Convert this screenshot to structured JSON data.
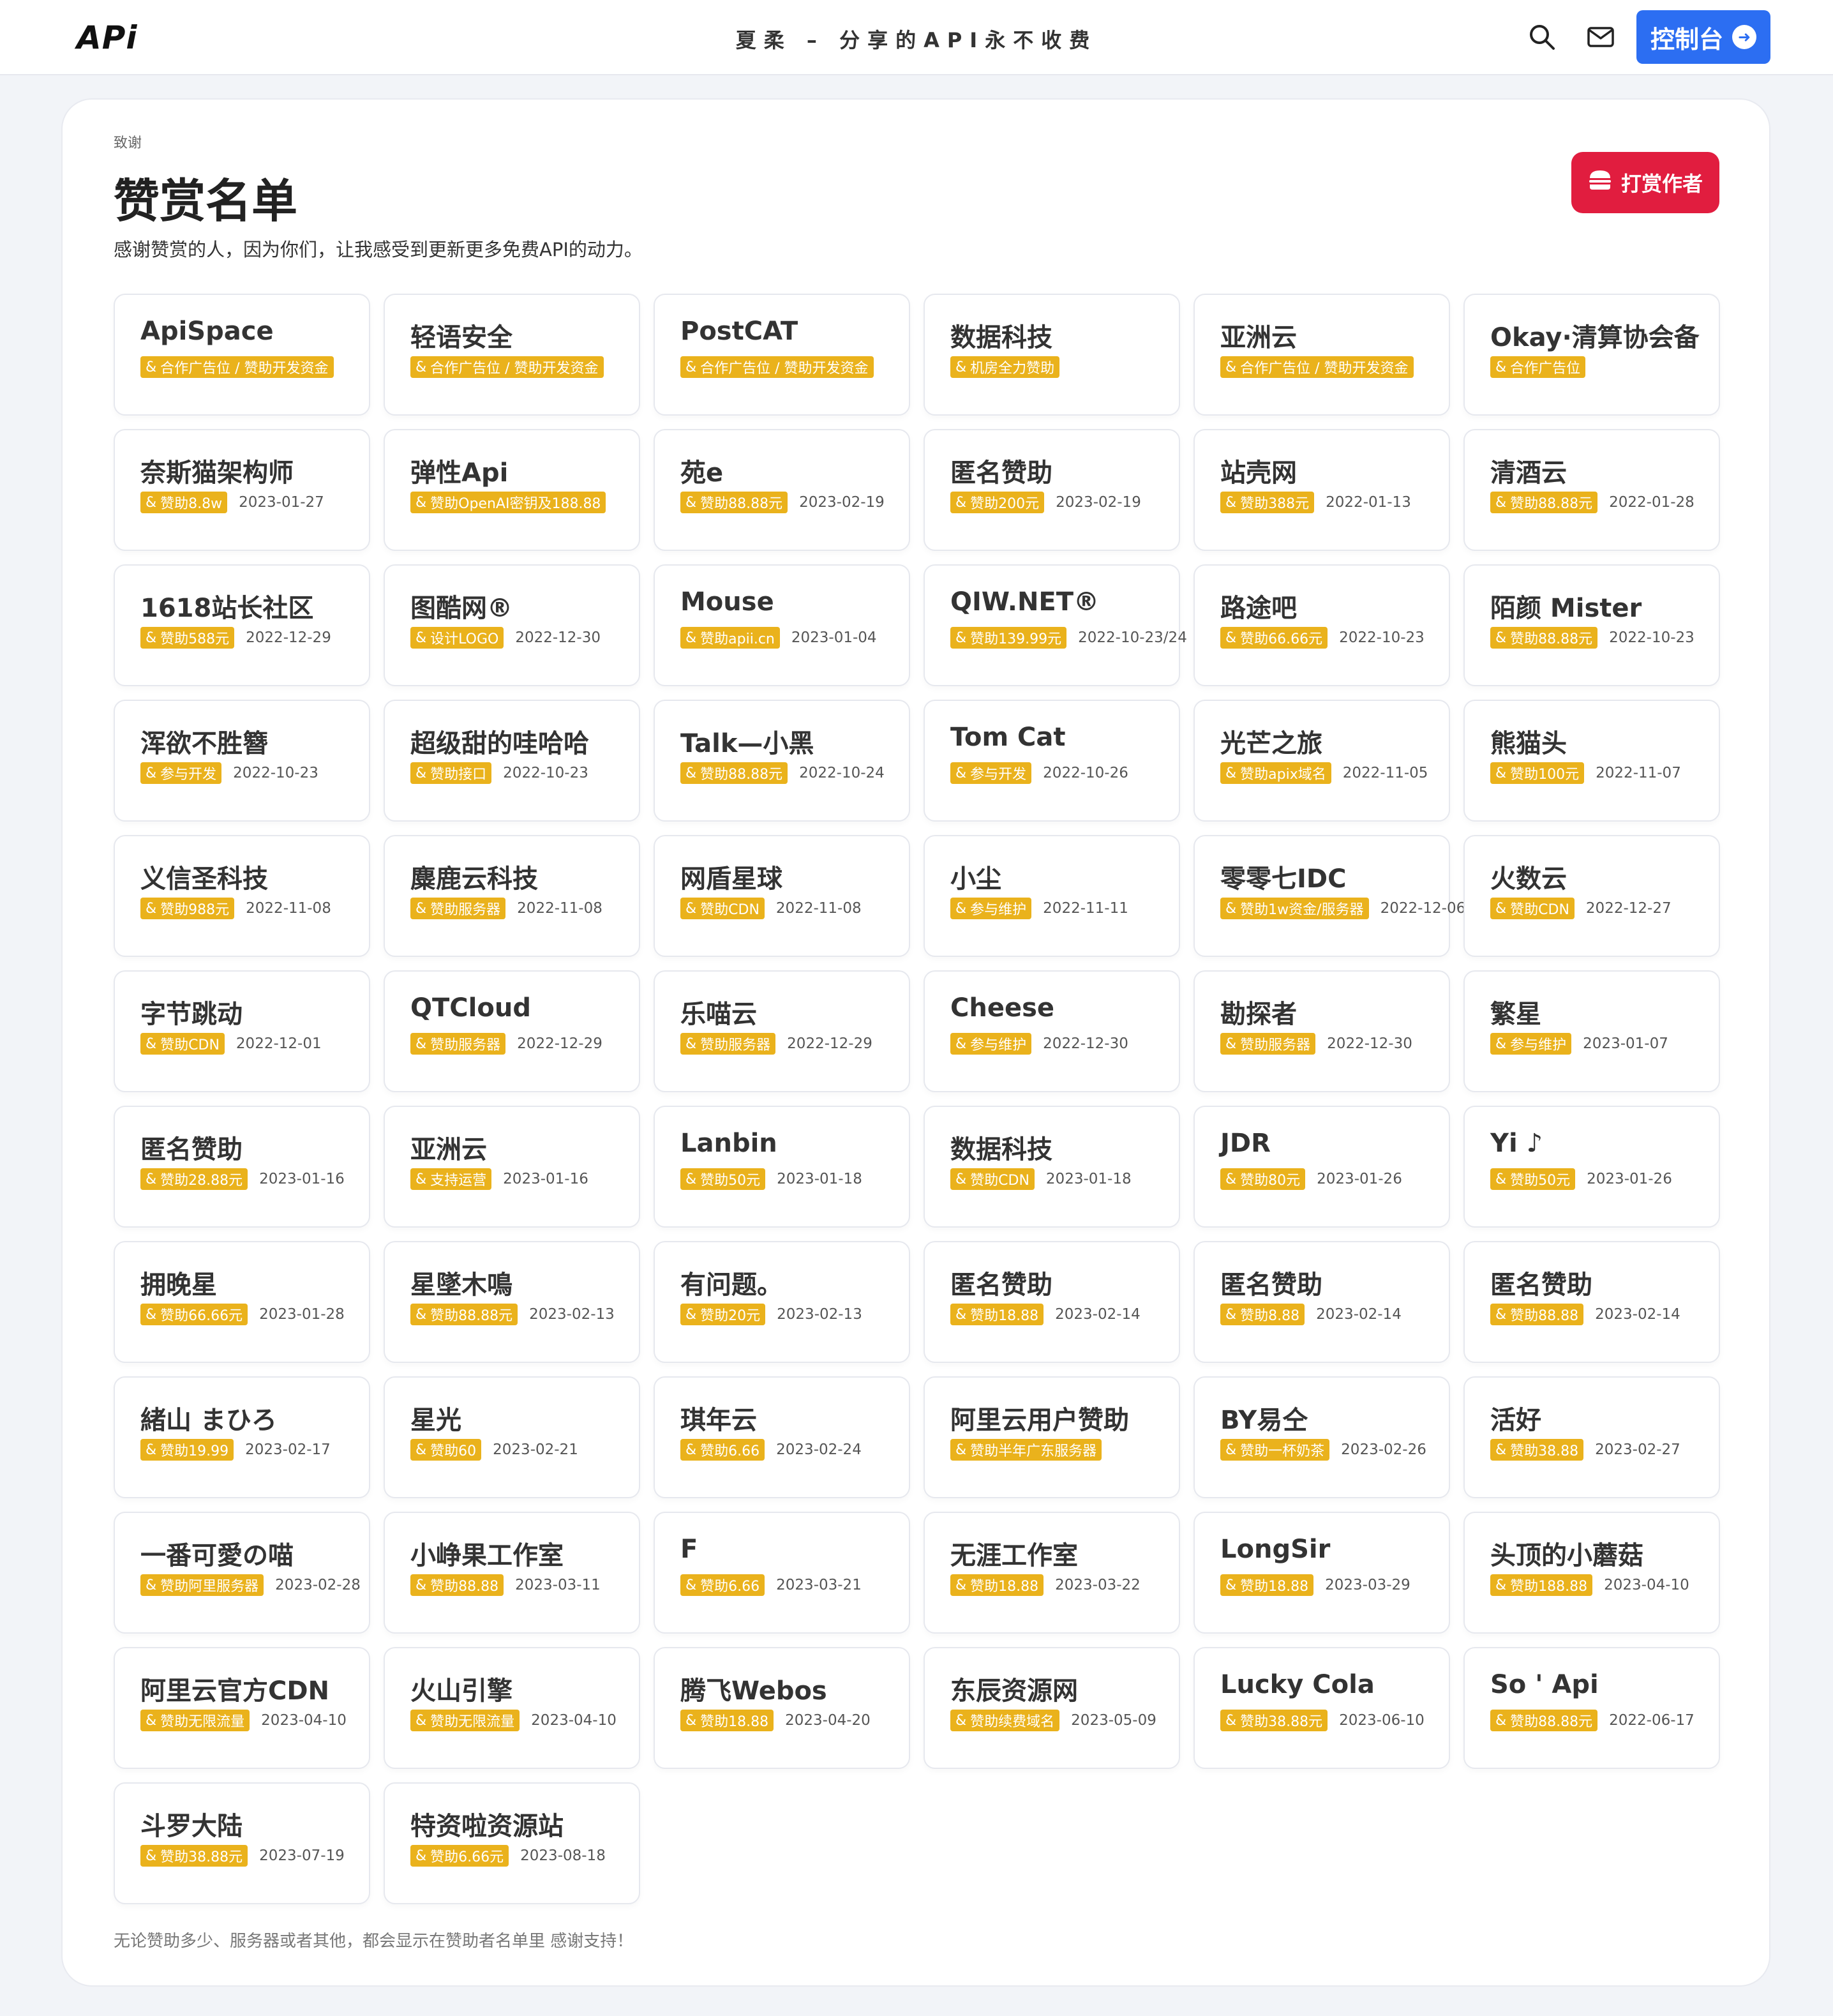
{
  "header": {
    "logo": "APi",
    "site_title": "夏柔 – 分享的API永不收费",
    "console_label": "控制台"
  },
  "page": {
    "breadcrumb": "致谢",
    "title": "赞赏名单",
    "subtitle": "感谢赞赏的人，因为你们，让我感受到更新更多免费API的动力。",
    "reward_button": "打赏作者",
    "footnote": "无论赞助多少、服务器或者其他，都会显示在赞助者名单里 感谢支持！"
  },
  "sponsors": [
    {
      "name": "ApiSpace",
      "tag": "合作广告位 / 赞助开发资金",
      "date": ""
    },
    {
      "name": "轻语安全",
      "tag": "合作广告位 / 赞助开发资金",
      "date": ""
    },
    {
      "name": "PostCAT",
      "tag": "合作广告位 / 赞助开发资金",
      "date": ""
    },
    {
      "name": "数据科技",
      "tag": "机房全力赞助",
      "date": ""
    },
    {
      "name": "亚洲云",
      "tag": "合作广告位 / 赞助开发资金",
      "date": ""
    },
    {
      "name": "Okay·清算协会备",
      "tag": "合作广告位",
      "date": ""
    },
    {
      "name": "奈斯猫架构师",
      "tag": "赞助8.8w",
      "date": "2023-01-27"
    },
    {
      "name": "弹性Api",
      "tag": "赞助OpenAI密钥及188.88",
      "date": ""
    },
    {
      "name": "苑e",
      "tag": "赞助88.88元",
      "date": "2023-02-19"
    },
    {
      "name": "匿名赞助",
      "tag": "赞助200元",
      "date": "2023-02-19"
    },
    {
      "name": "站壳网",
      "tag": "赞助388元",
      "date": "2022-01-13"
    },
    {
      "name": "清酒云",
      "tag": "赞助88.88元",
      "date": "2022-01-28"
    },
    {
      "name": "1618站长社区",
      "tag": "赞助588元",
      "date": "2022-12-29"
    },
    {
      "name": "图酷网®",
      "tag": "设计LOGO",
      "date": "2022-12-30"
    },
    {
      "name": "Mouse",
      "tag": "赞助apii.cn",
      "date": "2023-01-04"
    },
    {
      "name": "QIW.NET®",
      "tag": "赞助139.99元",
      "date": "2022-10-23/24"
    },
    {
      "name": "路途吧",
      "tag": "赞助66.66元",
      "date": "2022-10-23"
    },
    {
      "name": "陌颜 Mister",
      "tag": "赞助88.88元",
      "date": "2022-10-23"
    },
    {
      "name": "浑欲不胜簪",
      "tag": "参与开发",
      "date": "2022-10-23"
    },
    {
      "name": "超级甜的哇哈哈",
      "tag": "赞助接口",
      "date": "2022-10-23"
    },
    {
      "name": "Talk—小黑",
      "tag": "赞助88.88元",
      "date": "2022-10-24"
    },
    {
      "name": "Tom Cat",
      "tag": "参与开发",
      "date": "2022-10-26"
    },
    {
      "name": "光芒之旅",
      "tag": "赞助apix域名",
      "date": "2022-11-05"
    },
    {
      "name": "熊猫头",
      "tag": "赞助100元",
      "date": "2022-11-07"
    },
    {
      "name": "义信圣科技",
      "tag": "赞助988元",
      "date": "2022-11-08"
    },
    {
      "name": "麋鹿云科技",
      "tag": "赞助服务器",
      "date": "2022-11-08"
    },
    {
      "name": "网盾星球",
      "tag": "赞助CDN",
      "date": "2022-11-08"
    },
    {
      "name": "小尘",
      "tag": "参与维护",
      "date": "2022-11-11"
    },
    {
      "name": "零零七IDC",
      "tag": "赞助1w资金/服务器",
      "date": "2022-12-06"
    },
    {
      "name": "火数云",
      "tag": "赞助CDN",
      "date": "2022-12-27"
    },
    {
      "name": "字节跳动",
      "tag": "赞助CDN",
      "date": "2022-12-01"
    },
    {
      "name": "QTCloud",
      "tag": "赞助服务器",
      "date": "2022-12-29"
    },
    {
      "name": "乐喵云",
      "tag": "赞助服务器",
      "date": "2022-12-29"
    },
    {
      "name": "Cheese",
      "tag": "参与维护",
      "date": "2022-12-30"
    },
    {
      "name": "勘探者",
      "tag": "赞助服务器",
      "date": "2022-12-30"
    },
    {
      "name": "繁星",
      "tag": "参与维护",
      "date": "2023-01-07"
    },
    {
      "name": "匿名赞助",
      "tag": "赞助28.88元",
      "date": "2023-01-16"
    },
    {
      "name": "亚洲云",
      "tag": "支持运营",
      "date": "2023-01-16"
    },
    {
      "name": "Lanbin",
      "tag": "赞助50元",
      "date": "2023-01-18"
    },
    {
      "name": "数据科技",
      "tag": "赞助CDN",
      "date": "2023-01-18"
    },
    {
      "name": "JDR",
      "tag": "赞助80元",
      "date": "2023-01-26"
    },
    {
      "name": "Yi ♪",
      "tag": "赞助50元",
      "date": "2023-01-26"
    },
    {
      "name": "拥晚星",
      "tag": "赞助66.66元",
      "date": "2023-01-28"
    },
    {
      "name": "星墜木鳴",
      "tag": "赞助88.88元",
      "date": "2023-02-13"
    },
    {
      "name": "有问题。",
      "tag": "赞助20元",
      "date": "2023-02-13"
    },
    {
      "name": "匿名赞助",
      "tag": "赞助18.88",
      "date": "2023-02-14"
    },
    {
      "name": "匿名赞助",
      "tag": "赞助8.88",
      "date": "2023-02-14"
    },
    {
      "name": "匿名赞助",
      "tag": "赞助88.88",
      "date": "2023-02-14"
    },
    {
      "name": "緒山 まひろ",
      "tag": "赞助19.99",
      "date": "2023-02-17"
    },
    {
      "name": "星光",
      "tag": "赞助60",
      "date": "2023-02-21"
    },
    {
      "name": "琪年云",
      "tag": "赞助6.66",
      "date": "2023-02-24"
    },
    {
      "name": "阿里云用户赞助",
      "tag": "赞助半年广东服务器",
      "date": ""
    },
    {
      "name": "BY易仝",
      "tag": "赞助一杯奶茶",
      "date": "2023-02-26"
    },
    {
      "name": "活好",
      "tag": "赞助38.88",
      "date": "2023-02-27"
    },
    {
      "name": "一番可愛の喵",
      "tag": "赞助阿里服务器",
      "date": "2023-02-28"
    },
    {
      "name": "小峥果工作室",
      "tag": "赞助88.88",
      "date": "2023-03-11"
    },
    {
      "name": "F",
      "tag": "赞助6.66",
      "date": "2023-03-21"
    },
    {
      "name": "无涯工作室",
      "tag": "赞助18.88",
      "date": "2023-03-22"
    },
    {
      "name": "LongSir",
      "tag": "赞助18.88",
      "date": "2023-03-29"
    },
    {
      "name": "头顶的小蘑菇",
      "tag": "赞助188.88",
      "date": "2023-04-10"
    },
    {
      "name": "阿里云官方CDN",
      "tag": "赞助无限流量",
      "date": "2023-04-10"
    },
    {
      "name": "火山引擎",
      "tag": "赞助无限流量",
      "date": "2023-04-10"
    },
    {
      "name": "腾飞Webos",
      "tag": "赞助18.88",
      "date": "2023-04-20"
    },
    {
      "name": "东辰资源网",
      "tag": "赞助续费域名",
      "date": "2023-05-09"
    },
    {
      "name": "Lucky Cola",
      "tag": "赞助38.88元",
      "date": "2023-06-10"
    },
    {
      "name": "So ' Api",
      "tag": "赞助88.88元",
      "date": "2022-06-17"
    },
    {
      "name": "斗罗大陆",
      "tag": "赞助38.88元",
      "date": "2023-07-19"
    },
    {
      "name": "特资啦资源站",
      "tag": "赞助6.66元",
      "date": "2023-08-18"
    }
  ]
}
